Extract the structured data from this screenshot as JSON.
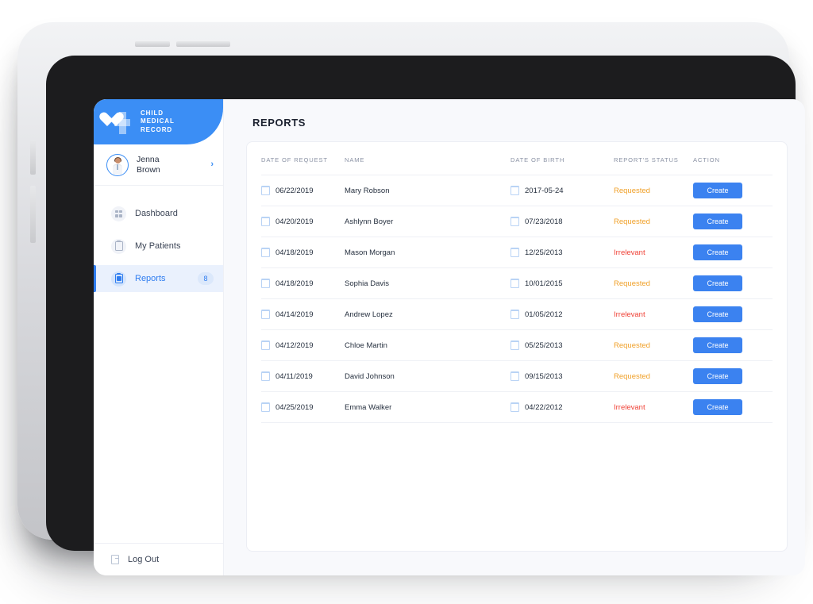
{
  "brand": {
    "name_lines": [
      "CHILD",
      "MEDICAL",
      "RECORD"
    ],
    "logo_icon": "heart-cross-icon",
    "color": "#3b8ef5"
  },
  "profile": {
    "name_line1": "Jenna",
    "name_line2": "Brown",
    "chevron": "›",
    "avatar_icon": "avatar-photo"
  },
  "sidebar": {
    "items": [
      {
        "label": "Dashboard",
        "icon": "grid-icon",
        "badge": "",
        "active": false
      },
      {
        "label": "My Patients",
        "icon": "clipboard-icon",
        "badge": "",
        "active": false
      },
      {
        "label": "Reports",
        "icon": "clipboard-icon",
        "badge": "8",
        "active": true
      }
    ],
    "logout": {
      "label": "Log Out",
      "icon": "logout-icon"
    }
  },
  "main": {
    "page_title": "REPORTS"
  },
  "table": {
    "columns": [
      "DATE OF REQUEST",
      "NAME",
      "DATE OF BIRTH",
      "REPORT'S STATUS",
      "ACTION"
    ],
    "action_label": "Create",
    "status_colors": {
      "Requested": "#f0a028",
      "Irrelevant": "#ef4136"
    },
    "rows": [
      {
        "date_of_request": "06/22/2019",
        "name": "Mary Robson",
        "date_of_birth": "2017-05-24",
        "status": "Requested",
        "action": "Create"
      },
      {
        "date_of_request": "04/20/2019",
        "name": "Ashlynn Boyer",
        "date_of_birth": "07/23/2018",
        "status": "Requested",
        "action": "Create"
      },
      {
        "date_of_request": "04/18/2019",
        "name": "Mason Morgan",
        "date_of_birth": "12/25/2013",
        "status": "Irrelevant",
        "action": "Create"
      },
      {
        "date_of_request": "04/18/2019",
        "name": "Sophia Davis",
        "date_of_birth": "10/01/2015",
        "status": "Requested",
        "action": "Create"
      },
      {
        "date_of_request": "04/14/2019",
        "name": "Andrew Lopez",
        "date_of_birth": "01/05/2012",
        "status": "Irrelevant",
        "action": "Create"
      },
      {
        "date_of_request": "04/12/2019",
        "name": "Chloe Martin",
        "date_of_birth": "05/25/2013",
        "status": "Requested",
        "action": "Create"
      },
      {
        "date_of_request": "04/11/2019",
        "name": "David Johnson",
        "date_of_birth": "09/15/2013",
        "status": "Requested",
        "action": "Create"
      },
      {
        "date_of_request": "04/25/2019",
        "name": "Emma Walker",
        "date_of_birth": "04/22/2012",
        "status": "Irrelevant",
        "action": "Create"
      }
    ]
  }
}
